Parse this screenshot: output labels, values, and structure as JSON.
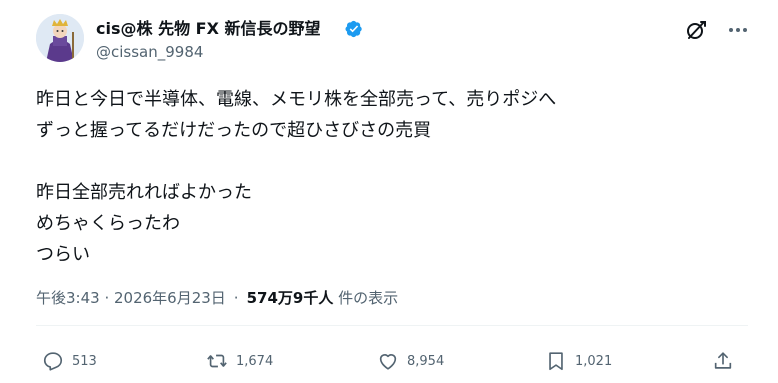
{
  "author": {
    "name": "cis@株 先物 FX 新信長の野望",
    "handle": "@cissan_9984"
  },
  "post": {
    "lines": [
      "昨日と今日で半導体、電線、メモリ株を全部売って、売りポジへ",
      "ずっと握ってるだけだったので超ひさびさの売買",
      "",
      "昨日全部売れればよかった",
      "めちゃくらったわ",
      "つらい"
    ]
  },
  "meta": {
    "timestamp": "午後3:43 · 2026年6月23日",
    "separator": "·",
    "views_count": "574万9千人",
    "views_label": "件の表示"
  },
  "actions": {
    "reply_count": "513",
    "retweet_count": "1,674",
    "like_count": "8,954",
    "bookmark_count": "1,021"
  },
  "icons": {
    "verified": "verified-badge-icon",
    "grok": "grok-icon",
    "more": "more-icon",
    "reply": "reply-icon",
    "retweet": "retweet-icon",
    "like": "heart-icon",
    "bookmark": "bookmark-icon",
    "share": "share-icon"
  },
  "colors": {
    "text": "#0f1419",
    "secondary": "#536471",
    "verified": "#1d9bf0",
    "divider": "#eff3f4"
  }
}
